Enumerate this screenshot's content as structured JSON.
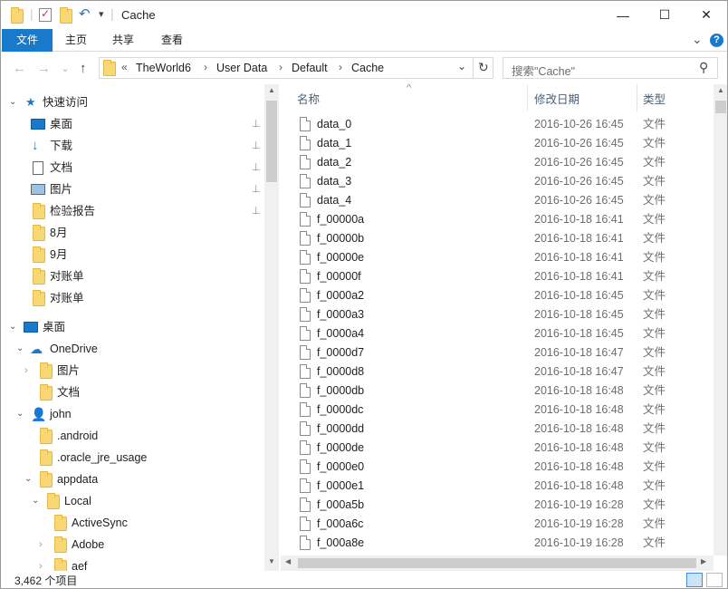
{
  "window": {
    "title": "Cache",
    "minimize_glyph": "—",
    "maximize_glyph": "☐",
    "close_glyph": "✕"
  },
  "quick_access_toolbar": {
    "separator": "|",
    "dropdown_glyph": "▾"
  },
  "ribbon": {
    "tabs": [
      "文件",
      "主页",
      "共享",
      "查看"
    ],
    "expand_glyph": "⌄",
    "help_glyph": "?"
  },
  "nav": {
    "back_glyph": "←",
    "forward_glyph": "→",
    "recent_glyph": "⌄",
    "up_glyph": "↑",
    "overflow_glyph": "«",
    "breadcrumb": [
      "TheWorld6",
      "User Data",
      "Default",
      "Cache"
    ],
    "sep_glyph": "›",
    "dropdown_glyph": "⌄",
    "refresh_glyph": "↻"
  },
  "search": {
    "placeholder": "搜索\"Cache\"",
    "icon_glyph": "⚲"
  },
  "navpane": {
    "quick_access": "快速访问",
    "pinned": [
      "桌面",
      "下载",
      "文档",
      "图片",
      "检验报告"
    ],
    "recent": [
      "8月",
      "9月",
      "对账单",
      "对账单"
    ],
    "pin_glyph": "📌",
    "desktop": "桌面",
    "onedrive": "OneDrive",
    "onedrive_children": [
      "图片",
      "文档"
    ],
    "user": "john",
    "user_children": [
      ".android",
      ".oracle_jre_usage",
      "appdata"
    ],
    "local": "Local",
    "local_children": [
      "ActiveSync",
      "Adobe",
      "aef"
    ]
  },
  "columns": {
    "name": "名称",
    "modified": "修改日期",
    "type": "类型",
    "sort_glyph": "^"
  },
  "files": [
    {
      "name": "data_0",
      "date": "2016-10-26 16:45",
      "type": "文件"
    },
    {
      "name": "data_1",
      "date": "2016-10-26 16:45",
      "type": "文件"
    },
    {
      "name": "data_2",
      "date": "2016-10-26 16:45",
      "type": "文件"
    },
    {
      "name": "data_3",
      "date": "2016-10-26 16:45",
      "type": "文件"
    },
    {
      "name": "data_4",
      "date": "2016-10-26 16:45",
      "type": "文件"
    },
    {
      "name": "f_00000a",
      "date": "2016-10-18 16:41",
      "type": "文件"
    },
    {
      "name": "f_00000b",
      "date": "2016-10-18 16:41",
      "type": "文件"
    },
    {
      "name": "f_00000e",
      "date": "2016-10-18 16:41",
      "type": "文件"
    },
    {
      "name": "f_00000f",
      "date": "2016-10-18 16:41",
      "type": "文件"
    },
    {
      "name": "f_0000a2",
      "date": "2016-10-18 16:45",
      "type": "文件"
    },
    {
      "name": "f_0000a3",
      "date": "2016-10-18 16:45",
      "type": "文件"
    },
    {
      "name": "f_0000a4",
      "date": "2016-10-18 16:45",
      "type": "文件"
    },
    {
      "name": "f_0000d7",
      "date": "2016-10-18 16:47",
      "type": "文件"
    },
    {
      "name": "f_0000d8",
      "date": "2016-10-18 16:47",
      "type": "文件"
    },
    {
      "name": "f_0000db",
      "date": "2016-10-18 16:48",
      "type": "文件"
    },
    {
      "name": "f_0000dc",
      "date": "2016-10-18 16:48",
      "type": "文件"
    },
    {
      "name": "f_0000dd",
      "date": "2016-10-18 16:48",
      "type": "文件"
    },
    {
      "name": "f_0000de",
      "date": "2016-10-18 16:48",
      "type": "文件"
    },
    {
      "name": "f_0000e0",
      "date": "2016-10-18 16:48",
      "type": "文件"
    },
    {
      "name": "f_0000e1",
      "date": "2016-10-18 16:48",
      "type": "文件"
    },
    {
      "name": "f_000a5b",
      "date": "2016-10-19 16:28",
      "type": "文件"
    },
    {
      "name": "f_000a6c",
      "date": "2016-10-19 16:28",
      "type": "文件"
    },
    {
      "name": "f_000a8e",
      "date": "2016-10-19 16:28",
      "type": "文件"
    }
  ],
  "status": {
    "item_count": "3,462 个项目"
  },
  "colors": {
    "accent": "#1979ca",
    "folder": "#f8d775",
    "header_text": "#4c607a"
  }
}
